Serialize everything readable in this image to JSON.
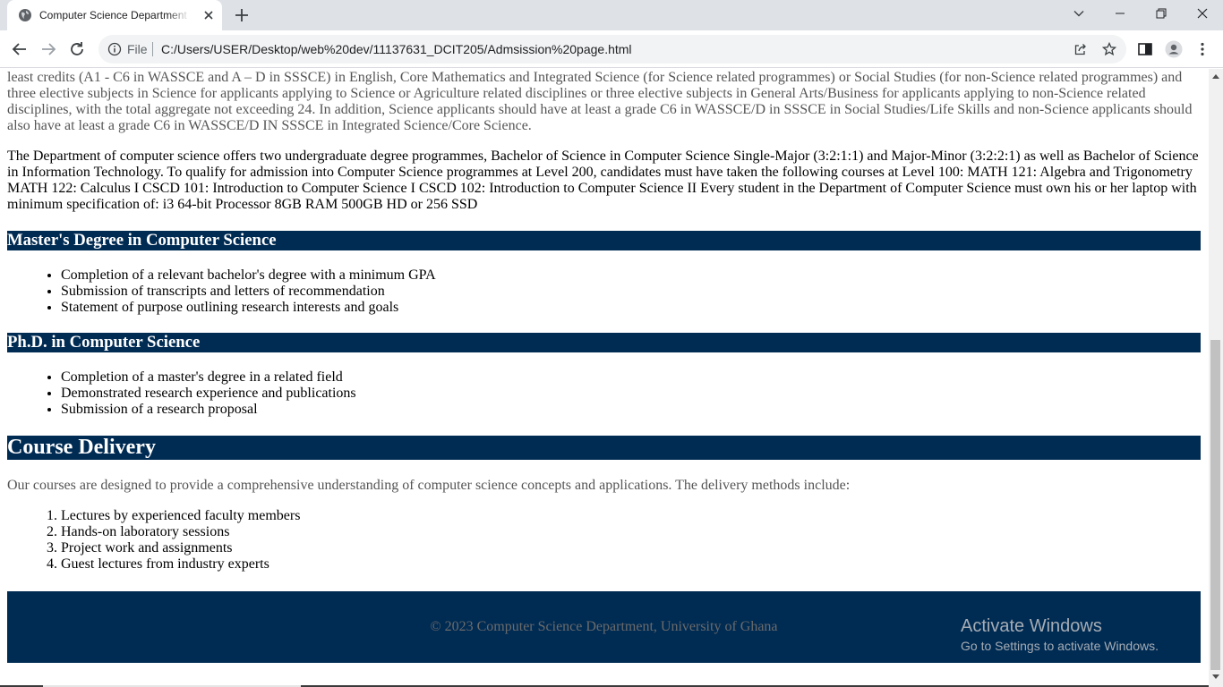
{
  "browser": {
    "tab_title": "Computer Science Department / Admission",
    "scheme_label": "File",
    "url": "C:/Users/USER/Desktop/web%20dev/11137631_DCIT205/Admsission%20page.html"
  },
  "page": {
    "intro_partial": "academic year. Applicants should take note of the following: GHANA WASSCE/SSSCE - Minimum/General Entry An applicant for admission to a degree programme in the University of Ghana must have at least credits (A1 - C6 in WASSCE and A – D in SSSCE) in English, Core Mathematics and Integrated Science (for Science related programmes) or Social Studies (for non-Science related programmes) and three elective subjects in Science for applicants applying to Science or Agriculture related disciplines or three elective subjects in General Arts/Business for applicants applying to non-Science related disciplines, with the total aggregate not exceeding 24. In addition, Science applicants should have at least a grade C6 in WASSCE/D in SSSCE in Social Studies/Life Skills and non-Science applicants should also have at least a grade C6 in WASSCE/D IN SSSCE in Integrated Science/Core Science.",
    "undergrad_paragraph": "The Department of computer science offers two undergraduate degree programmes, Bachelor of Science in Computer Science Single-Major (3:2:1:1) and Major-Minor (3:2:2:1) as well as Bachelor of Science in Information Technology. To qualify for admission into Computer Science programmes at Level 200, candidates must have taken the following courses at Level 100: MATH 121: Algebra and Trigonometry MATH 122: Calculus I CSCD 101: Introduction to Computer Science I CSCD 102: Introduction to Computer Science II Every student in the Department of Computer Science must own his or her laptop with minimum specification of: i3 64-bit Processor 8GB RAM 500GB HD or 256 SSD",
    "masters": {
      "heading": "Master's Degree in Computer Science",
      "items": [
        "Completion of a relevant bachelor's degree with a minimum GPA",
        "Submission of transcripts and letters of recommendation",
        "Statement of purpose outlining research interests and goals"
      ]
    },
    "phd": {
      "heading": "Ph.D. in Computer Science",
      "items": [
        "Completion of a master's degree in a related field",
        "Demonstrated research experience and publications",
        "Submission of a research proposal"
      ]
    },
    "course_delivery": {
      "heading": "Course Delivery",
      "intro": "Our courses are designed to provide a comprehensive understanding of computer science concepts and applications. The delivery methods include:",
      "items": [
        "Lectures by experienced faculty members",
        "Hands-on laboratory sessions",
        "Project work and assignments",
        "Guest lectures from industry experts"
      ]
    },
    "footer_text": "© 2023 Computer Science Department, University of Ghana"
  },
  "overlay": {
    "activate_title": "Activate Windows",
    "activate_sub": "Go to Settings to activate Windows."
  },
  "colors": {
    "section_bar": "#002b53",
    "tabstrip": "#dee1e6"
  }
}
